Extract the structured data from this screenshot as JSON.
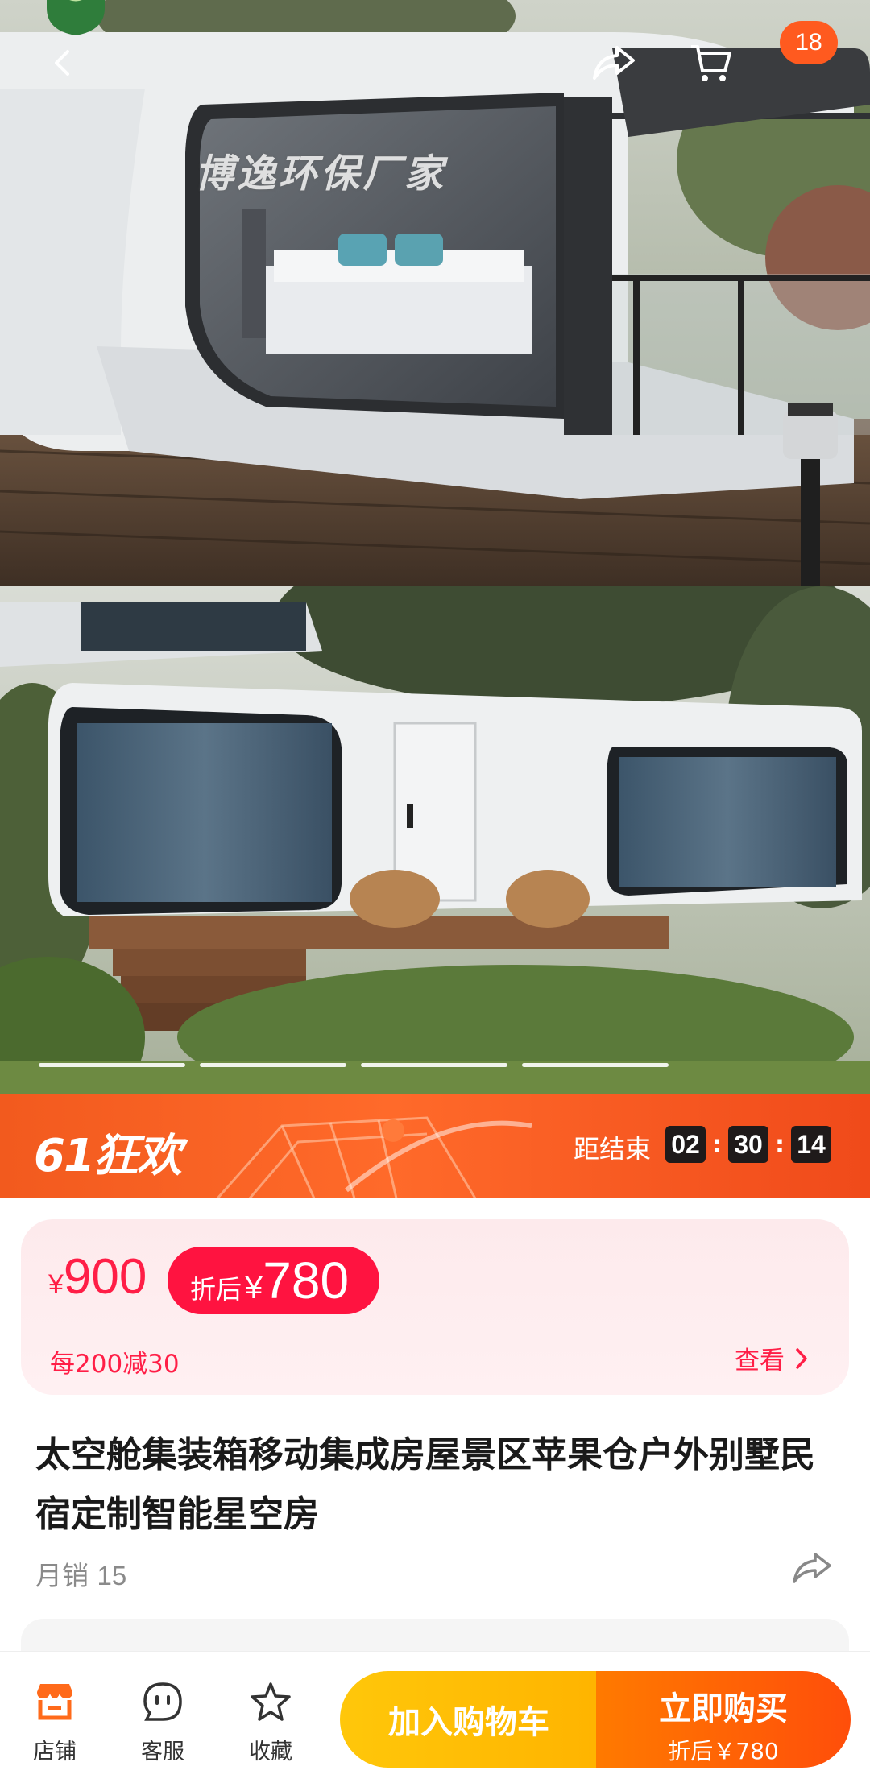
{
  "gallery": {
    "watermark": "博逸环保厂家",
    "cart_badge": "18",
    "slides_count": 4
  },
  "promo": {
    "title": "61狂欢",
    "countdown_label": "距结束",
    "hours": "02",
    "minutes": "30",
    "seconds": "14",
    "separator": ":"
  },
  "price": {
    "currency": "¥",
    "original": "900",
    "after_label": "折后",
    "after_value": "780",
    "coupon": "每200减30",
    "view_label": "查看"
  },
  "product": {
    "title": "太空舱集装箱移动集成房屋景区苹果仓户外别墅民宿定制智能星空房",
    "sales_label": "月销",
    "sales_count": "15"
  },
  "bottom_bar": {
    "shop_label": "店铺",
    "service_label": "客服",
    "favorite_label": "收藏",
    "add_cart_label": "加入购物车",
    "buy_now_label": "立即购买",
    "buy_now_sub": "折后￥780"
  },
  "colors": {
    "accent_red": "#ff1340",
    "promo_orange": "#f25a1e",
    "cart_yellow": "#ffc70a",
    "buy_orange": "#ff5a0a"
  }
}
